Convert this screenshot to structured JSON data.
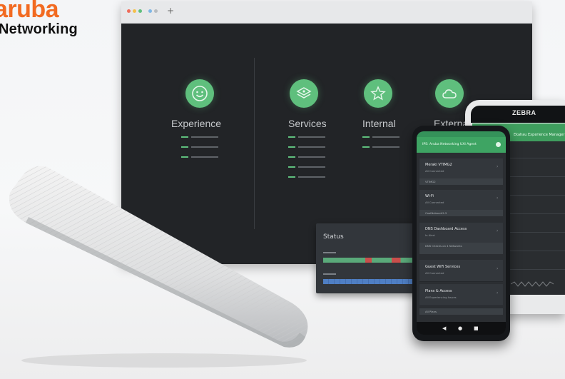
{
  "brand": {
    "wordmark": "aruba",
    "subline": "Networking",
    "accent": "#f26a21"
  },
  "browser": {
    "tab_plus": "+",
    "accent": "#5fbf7d",
    "categories": [
      {
        "label": "Experience",
        "icon": "smiley-icon"
      },
      {
        "label": "Services",
        "icon": "layers-icon"
      },
      {
        "label": "Internal",
        "icon": "star-icon"
      },
      {
        "label": "Externa",
        "icon": "cloud-icon"
      }
    ]
  },
  "status_card": {
    "title": "Status"
  },
  "zebra_device": {
    "logo": "ZEBRA",
    "header": "Ekahau Experience Manager"
  },
  "phone": {
    "header": "IPS: Aruba Networking UXI Agent",
    "items": [
      {
        "title": "Meraki VTIMG2",
        "sub": "All Connected",
        "strip": "VTIMG2"
      },
      {
        "title": "Wi-Fi",
        "sub": "All Connected",
        "strip": "CoolNetwork2-5"
      },
      {
        "title": "DNS Dashboard Access",
        "sub": "In Alert",
        "strip": "DNS Checks on 4 Networks"
      },
      {
        "title": "Guest WiFi Services",
        "sub": "All Connected",
        "strip": ""
      },
      {
        "title": "Plans & Access",
        "sub": "All Experiencing Issues",
        "strip": "All Plans"
      }
    ]
  }
}
